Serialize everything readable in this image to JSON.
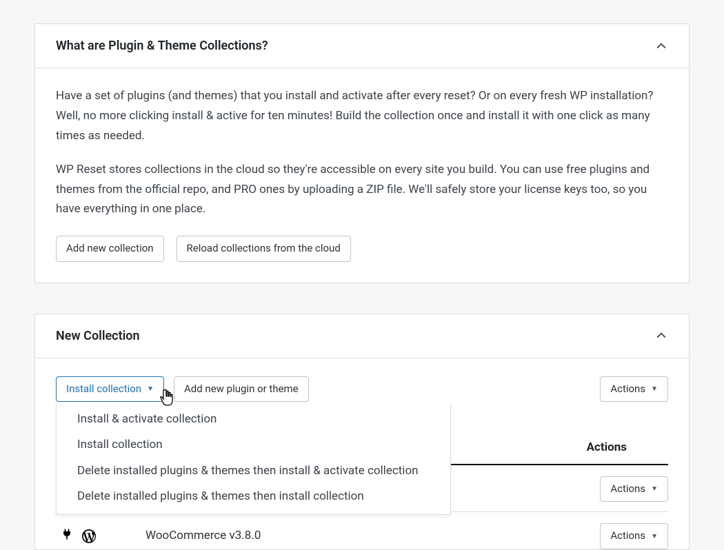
{
  "panel1": {
    "title": "What are Plugin & Theme Collections?",
    "para1": "Have a set of plugins (and themes) that you install and activate after every reset? Or on every fresh WP installation? Well, no more clicking install & active for ten minutes! Build the collection once and install it with one click as many times as needed.",
    "para2": "WP Reset stores collections in the cloud so they're accessible on every site you build. You can use free plugins and themes from the official repo, and PRO ones by uploading a ZIP file. We'll safely store your license keys too, so you have everything in one place.",
    "btn_add": "Add new collection",
    "btn_reload": "Reload collections from the cloud"
  },
  "panel2": {
    "title": "New Collection",
    "btn_install": "Install collection",
    "btn_add_item": "Add new plugin or theme",
    "btn_actions": "Actions",
    "dropdown": [
      "Install & activate collection",
      "Install collection",
      "Delete installed plugins & themes then install & activate collection",
      "Delete installed plugins & themes then install collection"
    ],
    "table": {
      "header_actions": "Actions",
      "rows": [
        {
          "name": "WooCommerce v3.8.0",
          "action_label": "Actions"
        }
      ],
      "row_action_above": "Actions"
    }
  }
}
